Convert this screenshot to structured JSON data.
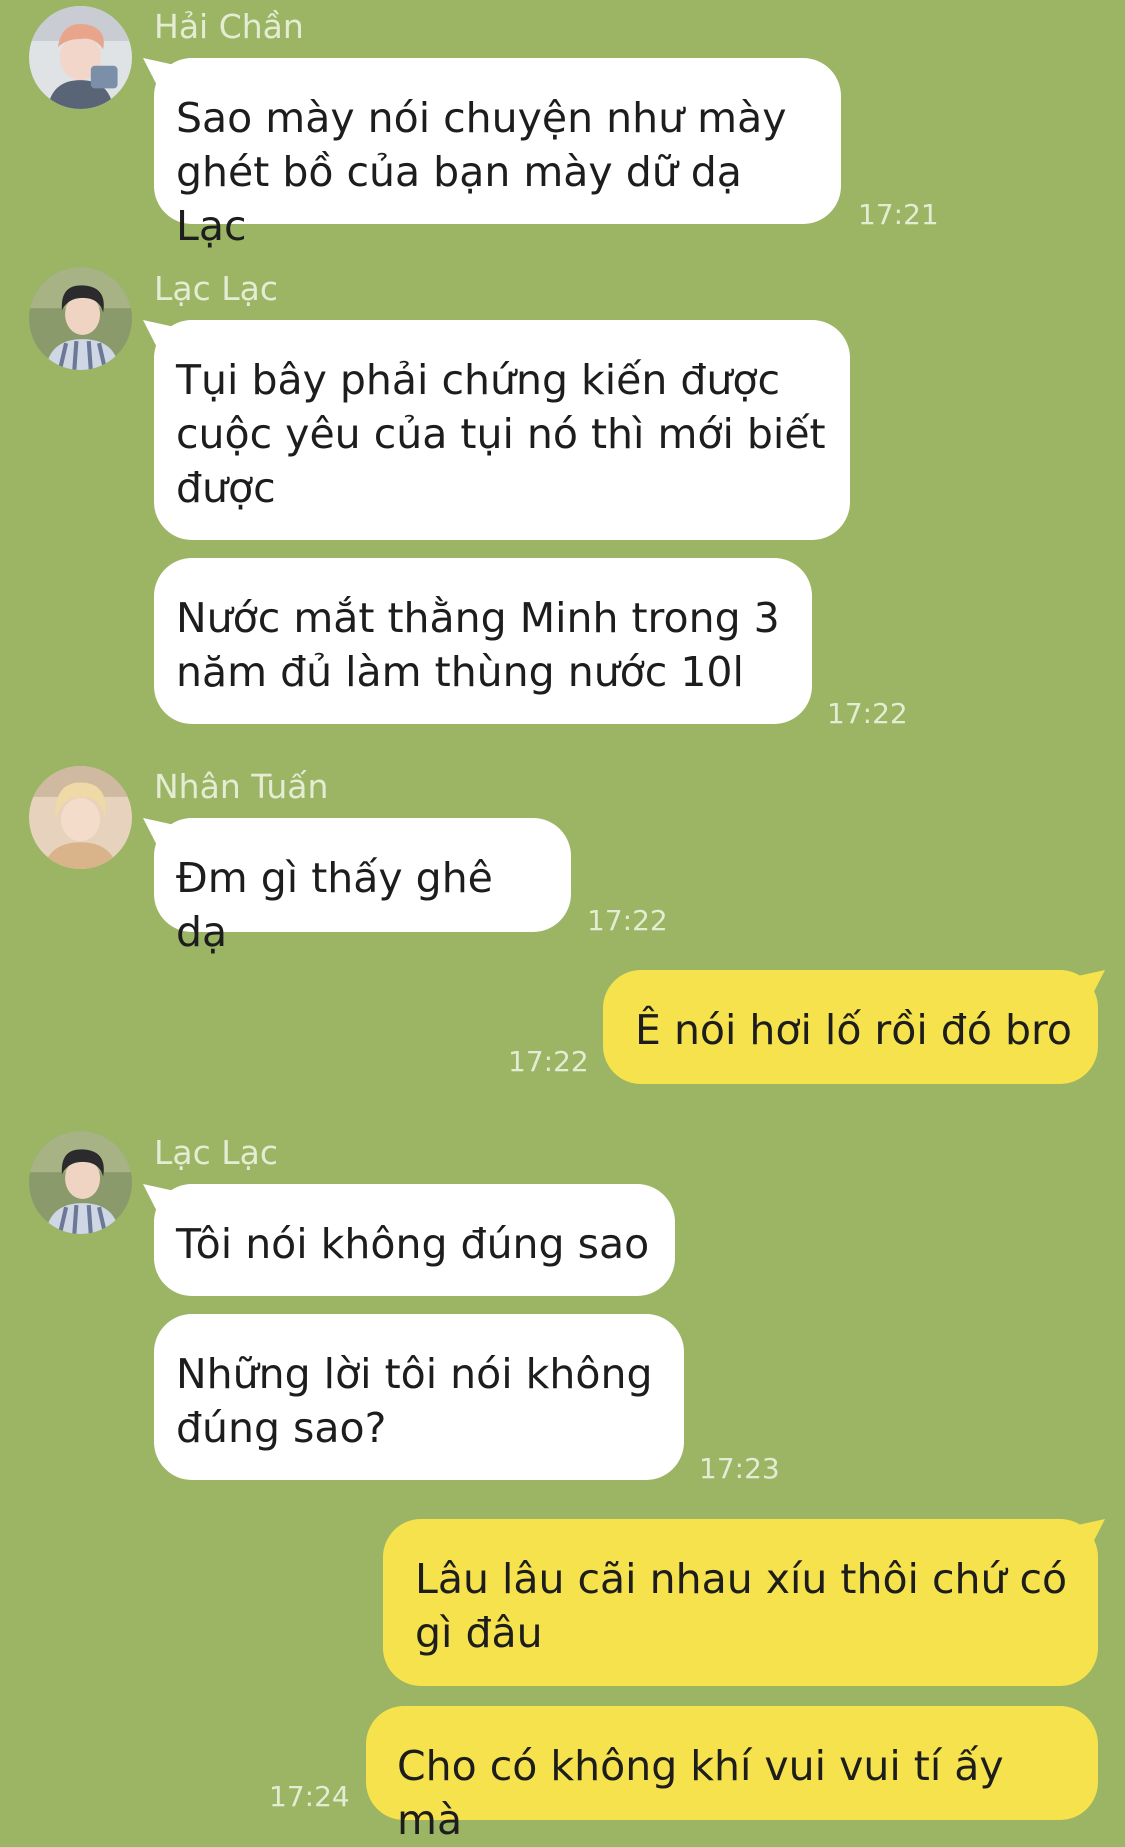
{
  "messages": [
    {
      "sender": "Hải Chần",
      "bubbles": [
        "Sao mày nói chuyện như mày\nghét bồ của bạn mày dữ dạ Lạc"
      ],
      "time": "17:21"
    },
    {
      "sender": "Lạc Lạc",
      "bubbles": [
        "Tụi bây phải chứng kiến được\ncuộc yêu của tụi nó thì mới biết\nđược",
        "Nước mắt thằng Minh trong 3\nnăm đủ làm thùng nước 10l"
      ],
      "time": "17:22"
    },
    {
      "sender": "Nhân Tuấn",
      "bubbles": [
        "Đm gì thấy ghê dạ"
      ],
      "time": "17:22"
    },
    {
      "sender": "me",
      "bubbles": [
        "Ê nói hơi lố rồi đó bro"
      ],
      "time": "17:22"
    },
    {
      "sender": "Lạc Lạc",
      "bubbles": [
        "Tôi nói không đúng sao",
        "Những lời tôi nói không\nđúng sao?"
      ],
      "time": "17:23"
    },
    {
      "sender": "me",
      "bubbles": [
        "Lâu lâu cãi nhau xíu thôi chứ có\ngì đâu",
        "Cho có không khí vui vui tí ấy mà"
      ],
      "time": "17:24"
    }
  ],
  "colors": {
    "background": "#9bb565",
    "incoming_bubble": "#ffffff",
    "outgoing_bubble": "#f6e24c",
    "meta_text": "#e4ecd3"
  },
  "icons": {
    "avatar_hai_chan": "avatar-photo",
    "avatar_lac_lac": "avatar-photo",
    "avatar_nhan_tuan": "avatar-photo"
  }
}
